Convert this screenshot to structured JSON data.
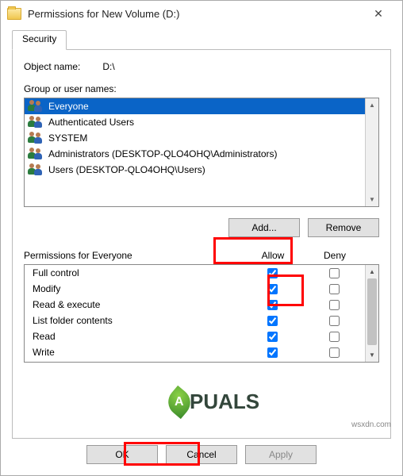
{
  "title": "Permissions for New Volume (D:)",
  "tab": "Security",
  "object_label": "Object name:",
  "object_value": "D:\\",
  "group_label": "Group or user names:",
  "users": [
    {
      "name": "Everyone",
      "selected": true
    },
    {
      "name": "Authenticated Users",
      "selected": false
    },
    {
      "name": "SYSTEM",
      "selected": false
    },
    {
      "name": "Administrators (DESKTOP-QLO4OHQ\\Administrators)",
      "selected": false
    },
    {
      "name": "Users (DESKTOP-QLO4OHQ\\Users)",
      "selected": false
    }
  ],
  "buttons": {
    "add": "Add...",
    "remove": "Remove",
    "ok": "OK",
    "cancel": "Cancel",
    "apply": "Apply"
  },
  "perm_label": "Permissions for Everyone",
  "cols": {
    "allow": "Allow",
    "deny": "Deny"
  },
  "perms": [
    {
      "name": "Full control",
      "allow": true,
      "deny": false
    },
    {
      "name": "Modify",
      "allow": true,
      "deny": false
    },
    {
      "name": "Read & execute",
      "allow": true,
      "deny": false
    },
    {
      "name": "List folder contents",
      "allow": true,
      "deny": false
    },
    {
      "name": "Read",
      "allow": true,
      "deny": false
    },
    {
      "name": "Write",
      "allow": true,
      "deny": false
    }
  ],
  "watermark": "wsxdn.com",
  "logo": {
    "leaf": "A",
    "text": "PUALS"
  }
}
